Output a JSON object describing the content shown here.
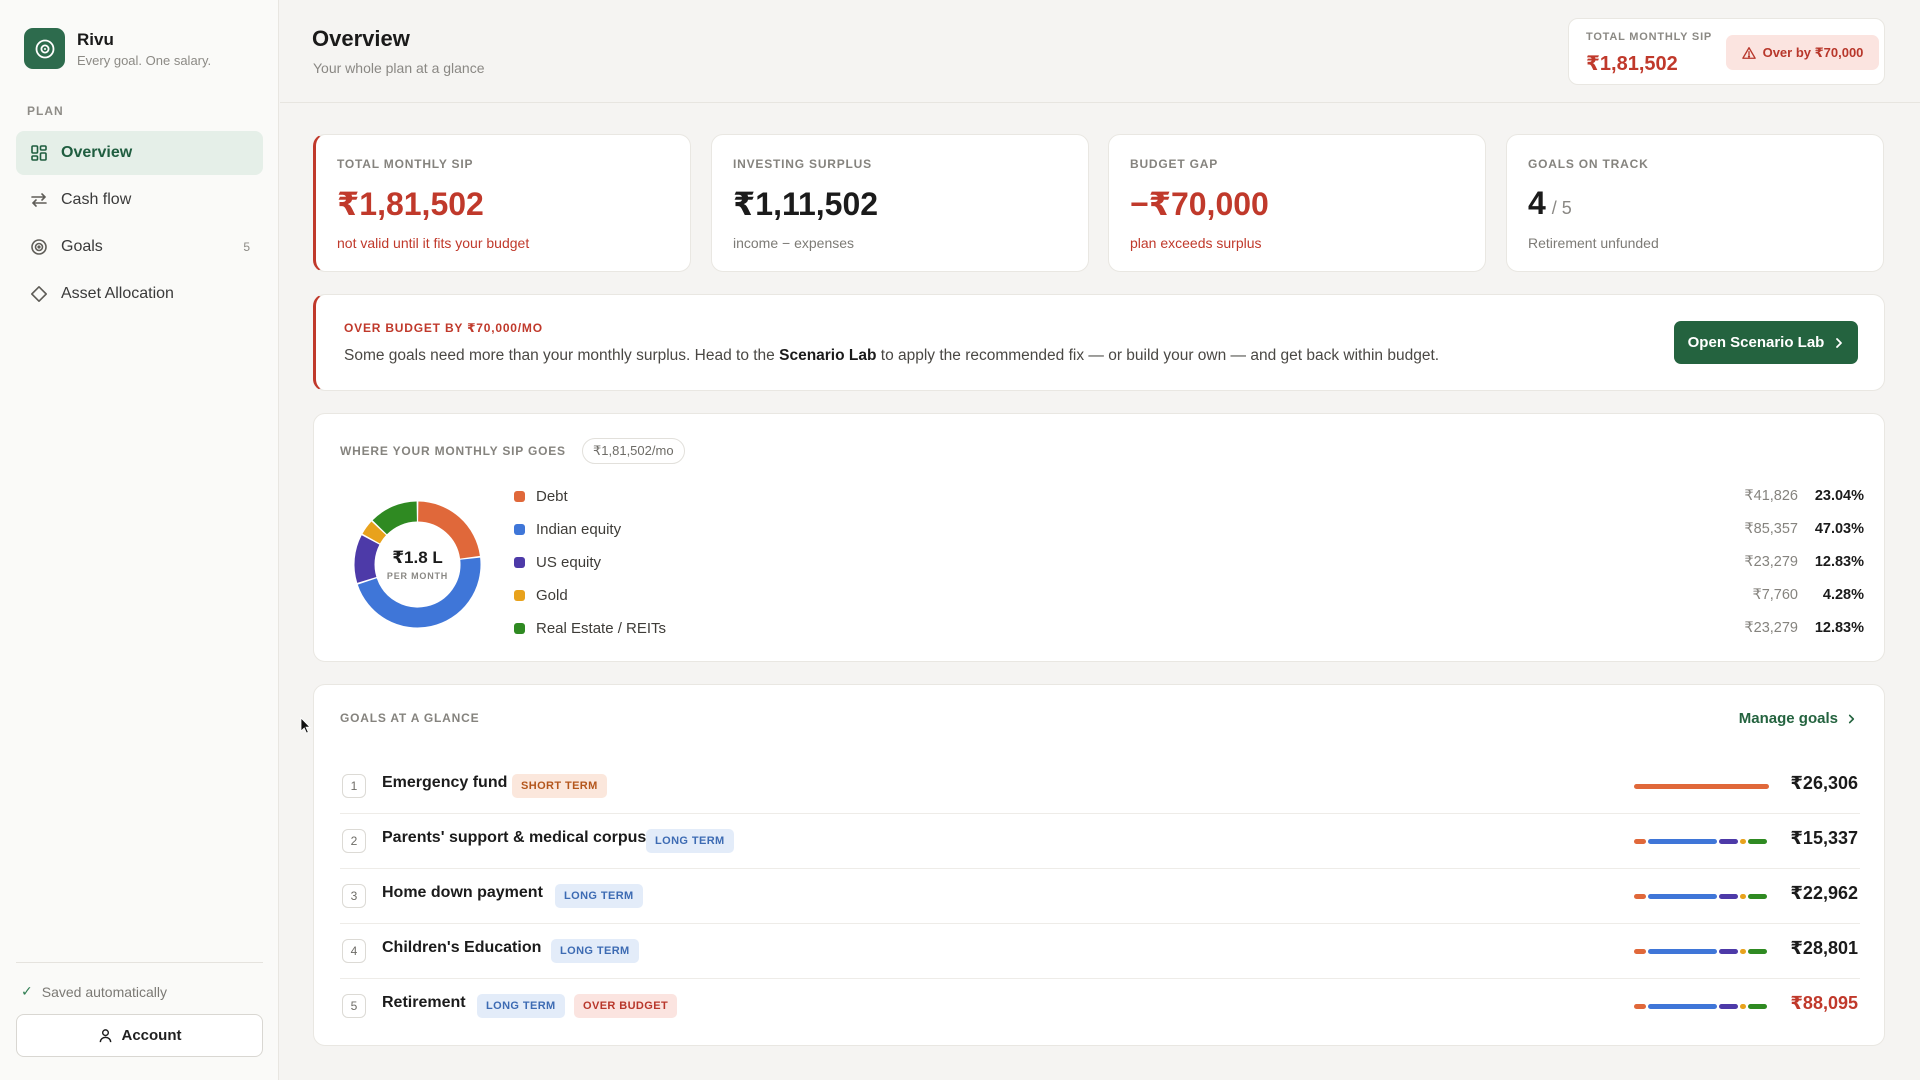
{
  "brand": {
    "name": "Rivu",
    "tagline": "Every goal. One salary."
  },
  "sidebar": {
    "section": "PLAN",
    "items": [
      {
        "label": "Overview",
        "icon": "grid-icon",
        "active": true
      },
      {
        "label": "Cash flow",
        "icon": "arrows-icon"
      },
      {
        "label": "Goals",
        "icon": "target-icon",
        "count": "5"
      },
      {
        "label": "Asset Allocation",
        "icon": "diamond-icon"
      }
    ],
    "saved": "Saved automatically",
    "account": "Account"
  },
  "header": {
    "title": "Overview",
    "subtitle": "Your whole plan at a glance",
    "sip_label": "TOTAL MONTHLY SIP",
    "sip_value": "₹1,81,502",
    "over_label": "Over by ₹70,000"
  },
  "stats": [
    {
      "label": "TOTAL MONTHLY SIP",
      "value": "₹1,81,502",
      "note": "not valid until it fits your budget"
    },
    {
      "label": "INVESTING SURPLUS",
      "value": "₹1,11,502",
      "note": "income − expenses"
    },
    {
      "label": "BUDGET GAP",
      "value": "−₹70,000",
      "note": "plan exceeds surplus"
    },
    {
      "label": "GOALS ON TRACK",
      "value": "4",
      "of": "/ 5",
      "note": "Retirement unfunded"
    }
  ],
  "banner": {
    "title": "OVER BUDGET BY ₹70,000/MO",
    "text_before": "Some goals need more than your monthly surplus. Head to the ",
    "text_bold": "Scenario Lab",
    "text_after": " to apply the recommended fix — or build your own — and get back within budget.",
    "button": "Open Scenario Lab"
  },
  "allocation": {
    "title": "WHERE YOUR MONTHLY SIP GOES",
    "pill": "₹1,81,502/mo",
    "center_value": "₹1.8 L",
    "center_label": "PER MONTH",
    "rows": [
      {
        "name": "Debt",
        "amount": "₹41,826",
        "pct": "23.04%",
        "value": 23.04,
        "color": "#e0683a"
      },
      {
        "name": "Indian equity",
        "amount": "₹85,357",
        "pct": "47.03%",
        "value": 47.03,
        "color": "#3f76d8"
      },
      {
        "name": "US equity",
        "amount": "₹23,279",
        "pct": "12.83%",
        "value": 12.83,
        "color": "#4d3aa8"
      },
      {
        "name": "Gold",
        "amount": "₹7,760",
        "pct": "4.28%",
        "value": 4.28,
        "color": "#e8a21c"
      },
      {
        "name": "Real Estate / REITs",
        "amount": "₹23,279",
        "pct": "12.83%",
        "value": 12.83,
        "color": "#2f8a22"
      }
    ]
  },
  "goals": {
    "title": "GOALS AT A GLANCE",
    "manage": "Manage goals",
    "items": [
      {
        "num": "1",
        "name": "Emergency fund",
        "tags": [
          {
            "text": "SHORT TERM",
            "kind": "short"
          }
        ],
        "amount": "₹26,306",
        "over": false,
        "mix": "debt"
      },
      {
        "num": "2",
        "name": "Parents' support & medical corpus",
        "tags": [
          {
            "text": "LONG TERM",
            "kind": "long"
          }
        ],
        "amount": "₹15,337",
        "over": false,
        "mix": "full"
      },
      {
        "num": "3",
        "name": "Home down payment",
        "tags": [
          {
            "text": "LONG TERM",
            "kind": "long"
          }
        ],
        "amount": "₹22,962",
        "over": false,
        "mix": "full"
      },
      {
        "num": "4",
        "name": "Children's Education",
        "tags": [
          {
            "text": "LONG TERM",
            "kind": "long"
          }
        ],
        "amount": "₹28,801",
        "over": false,
        "mix": "full"
      },
      {
        "num": "5",
        "name": "Retirement",
        "tags": [
          {
            "text": "LONG TERM",
            "kind": "long"
          },
          {
            "text": "OVER BUDGET",
            "kind": "over"
          }
        ],
        "amount": "₹88,095",
        "over": true,
        "mix": "full"
      }
    ]
  },
  "colors": {
    "accent": "#24633f",
    "danger": "#c0392b",
    "active_bg": "#e5efe8"
  }
}
